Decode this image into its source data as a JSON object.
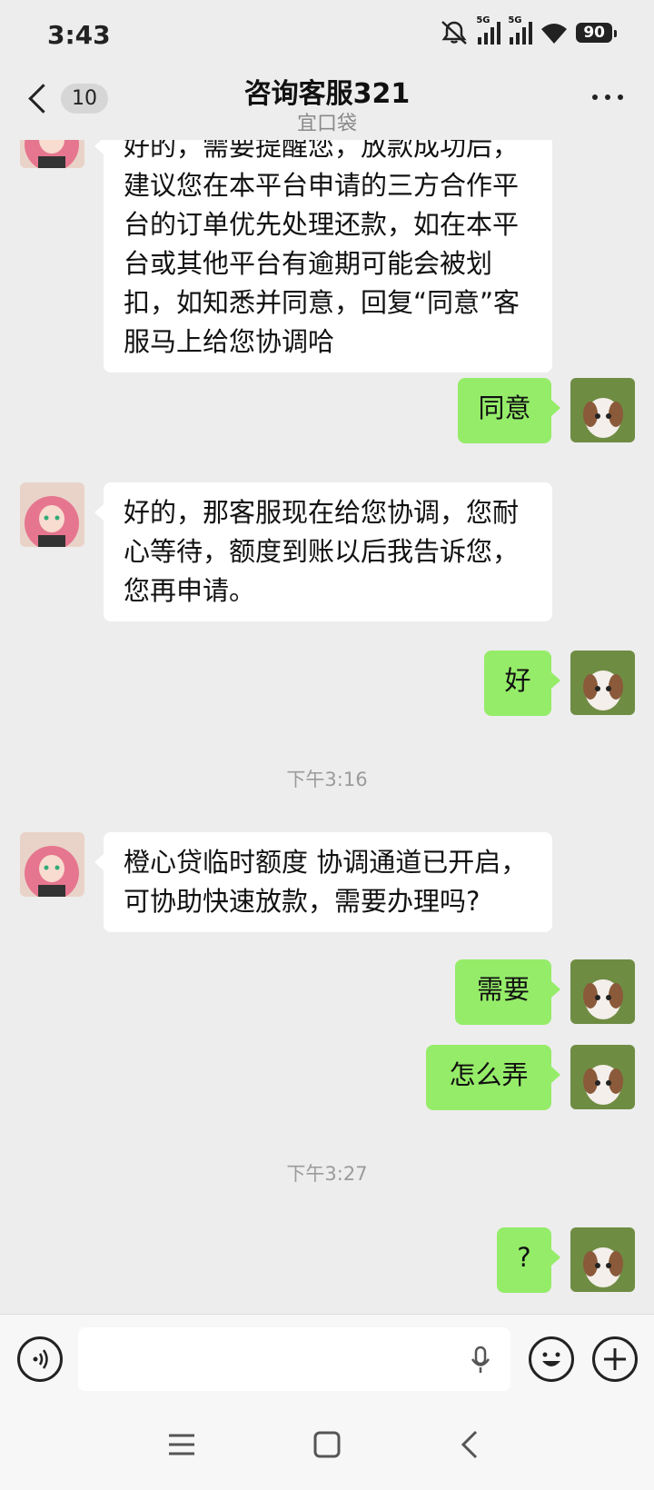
{
  "status": {
    "time": "3:43",
    "net1": "5G",
    "net2": "5G",
    "battery": "90"
  },
  "header": {
    "badge": "10",
    "title": "咨询客服321",
    "subtitle": "宜口袋"
  },
  "messages": {
    "m1": "好的，需要提醒您，放款成功后，建议您在本平台申请的三方合作平台的订单优先处理还款，如在本平台或其他平台有逾期可能会被划扣，如知悉并同意，回复“同意”客服马上给您协调哈",
    "m2": "同意",
    "m3": "好的，那客服现在给您协调，您耐心等待，额度到账以后我告诉您，您再申请。",
    "m4": "好",
    "ts1": "下午3:16",
    "m5": "橙心贷临时额度 协调通道已开启，可协助快速放款，需要办理吗?",
    "m6": "需要",
    "m7": "怎么弄",
    "ts2": "下午3:27",
    "m8": "?"
  },
  "input": {
    "placeholder": ""
  },
  "icons": {
    "back": "chevron-left-icon",
    "more": "more-dots-icon",
    "voice": "voice-icon",
    "mic": "microphone-icon",
    "emoji": "emoji-icon",
    "plus": "plus-icon",
    "nav_menu": "menu-icon",
    "nav_home": "home-icon",
    "nav_back": "back-icon"
  },
  "colors": {
    "background": "#ededed",
    "out_bubble": "#95ec69",
    "in_bubble": "#ffffff"
  }
}
